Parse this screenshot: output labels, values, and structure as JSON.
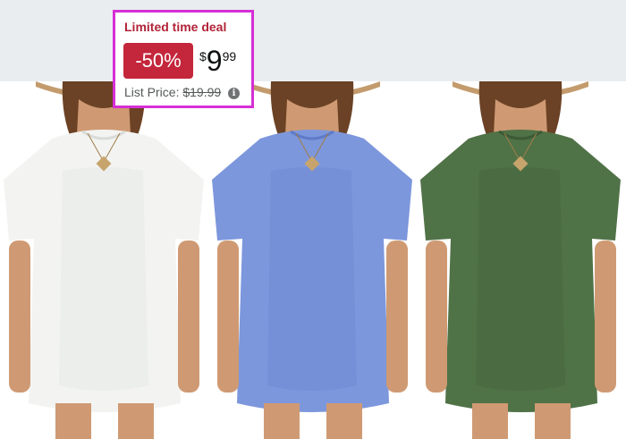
{
  "deal": {
    "badge_label": "Limited time deal",
    "discount": "-50%",
    "price_symbol": "$",
    "price_whole": "9",
    "price_fraction": "99",
    "list_price_label": "List Price:",
    "list_price": "$19.99",
    "info_icon": "info-icon"
  },
  "product_images": {
    "variants": [
      {
        "color_name": "white",
        "shirt_color": "#f3f4f2",
        "shirt_shade": "#d9dbd8"
      },
      {
        "color_name": "blue",
        "shirt_color": "#7d97dc",
        "shirt_shade": "#5f7bc8"
      },
      {
        "color_name": "green",
        "shirt_color": "#507247",
        "shirt_shade": "#3d5a36"
      }
    ]
  },
  "colors": {
    "highlight_border": "#d62fd6",
    "deal_red": "#c4263b",
    "background_band": "#eaedef"
  }
}
